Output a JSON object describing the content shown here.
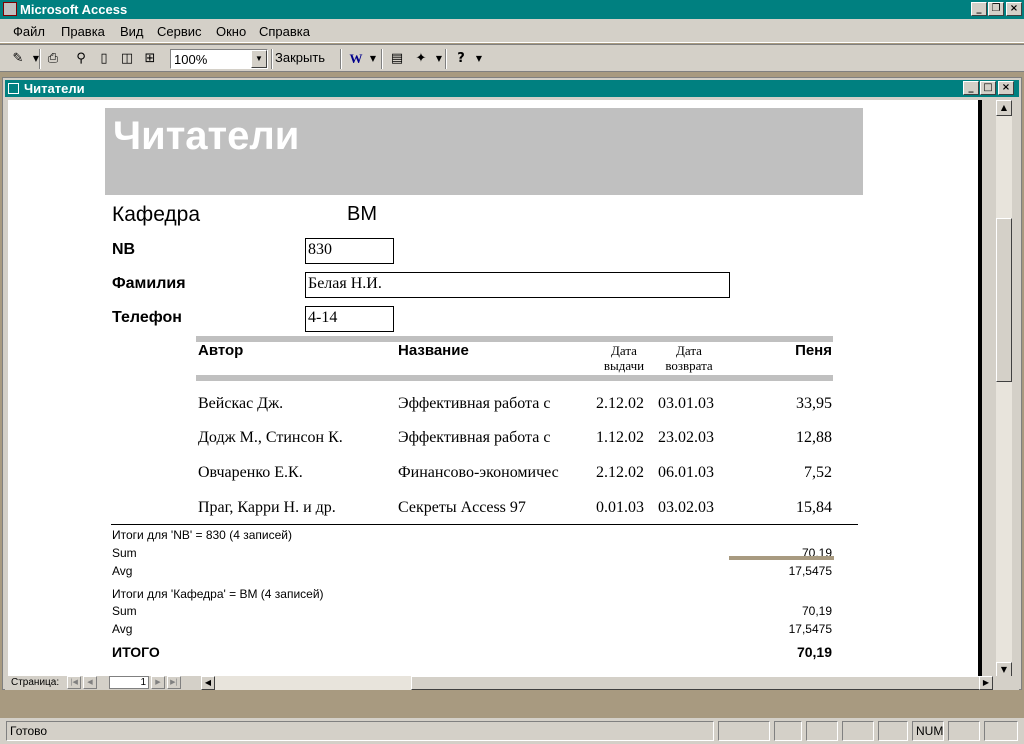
{
  "app": {
    "title": "Microsoft Access"
  },
  "menu": [
    "Файл",
    "Правка",
    "Вид",
    "Сервис",
    "Окно",
    "Справка"
  ],
  "toolbar": {
    "zoom": "100%",
    "close_label": "Закрыть"
  },
  "document": {
    "title": "Читатели"
  },
  "report": {
    "title": "Читатели",
    "dept_label": "Кафедра",
    "dept_value": "ВМ",
    "nb_label": "NB",
    "nb_value": "830",
    "surname_label": "Фамилия",
    "surname_value": "Белая Н.И.",
    "phone_label": "Телефон",
    "phone_value": "4-14",
    "columns": {
      "author": "Автор",
      "title": "Название",
      "issue_date": "Дата выдачи",
      "return_date": "Дата возврата",
      "fine": "Пеня"
    },
    "rows": [
      {
        "author": "Вейскас Дж.",
        "title": "Эффективная работа с",
        "issue": "2.12.02",
        "ret": "03.01.03",
        "fine": "33,95"
      },
      {
        "author": "Додж М., Стинсон К.",
        "title": "Эффективная работа с",
        "issue": "1.12.02",
        "ret": "23.02.03",
        "fine": "12,88"
      },
      {
        "author": "Овчаренко Е.К.",
        "title": "Финансово-экономичес",
        "issue": "2.12.02",
        "ret": "06.01.03",
        "fine": "7,52"
      },
      {
        "author": "Праг, Карри Н. и др.",
        "title": "Секреты Access 97",
        "issue": "0.01.03",
        "ret": "03.02.03",
        "fine": "15,84"
      }
    ],
    "group_nb": {
      "caption": "Итоги для 'NB' =  830 (4 записей)",
      "sum_label": "Sum",
      "sum_value": "70,19",
      "avg_label": "Avg",
      "avg_value": "17,5475"
    },
    "group_dept": {
      "caption": "Итоги для 'Кафедра' =  ВМ (4 записей)",
      "sum_label": "Sum",
      "sum_value": "70,19",
      "avg_label": "Avg",
      "avg_value": "17,5475"
    },
    "total_label": "ИТОГО",
    "total_value": "70,19"
  },
  "nav": {
    "page_label": "Страница:",
    "page_number": "1"
  },
  "status": {
    "text": "Готово",
    "num": "NUM"
  }
}
